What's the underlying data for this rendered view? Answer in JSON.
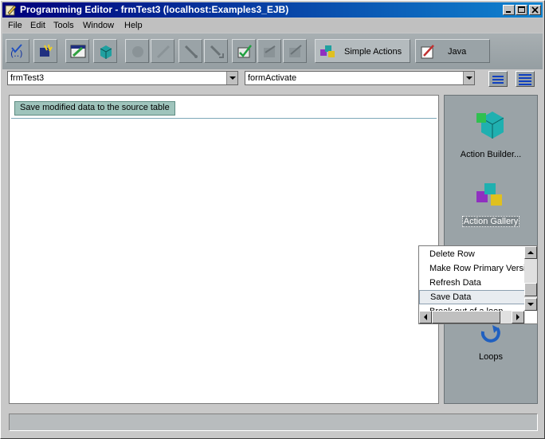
{
  "window": {
    "title": "Programming Editor - frmTest3  (localhost:Examples3_EJB)"
  },
  "menu": [
    "File",
    "Edit",
    "Tools",
    "Window",
    "Help"
  ],
  "toolbar": {
    "simple_actions_label": "Simple Actions",
    "java_label": "Java"
  },
  "selectors": {
    "object_value": "frmTest3",
    "event_value": "formActivate"
  },
  "editor": {
    "action_text": "Save modified data to the source table"
  },
  "panel": {
    "action_builder_label": "Action Builder...",
    "action_gallery_label": "Action Gallery",
    "loops_label": "Loops"
  },
  "list": {
    "items": [
      "Delete Row",
      "Make Row Primary Version",
      "Refresh Data",
      "Save Data",
      "Break out of a loop"
    ],
    "selected": "Save Data"
  },
  "colors": {
    "title_start": "#00007b",
    "title_end": "#1084d0",
    "toolbar": "#9aa3a7",
    "chip": "#9fc4bc"
  }
}
